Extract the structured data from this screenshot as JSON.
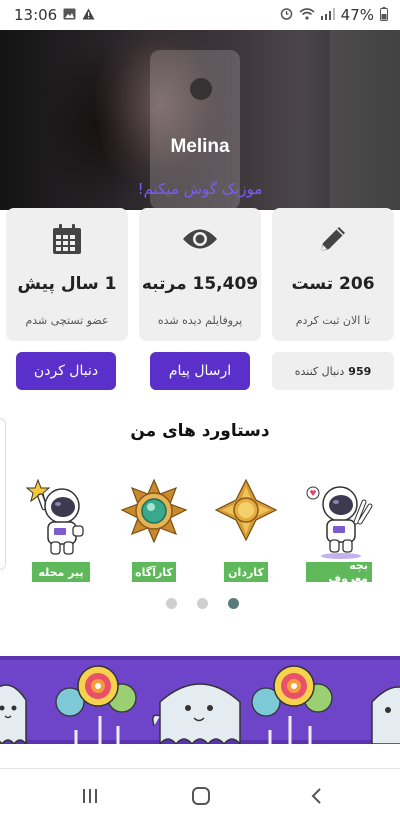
{
  "status_bar": {
    "time": "13:06",
    "battery": "47%",
    "icons": [
      "image-icon",
      "warning-icon",
      "alarm-icon",
      "wifi-icon",
      "signal-icon",
      "battery-icon"
    ]
  },
  "profile": {
    "name": "Melina",
    "bio": "موزیک گوش میکنم!"
  },
  "stats": [
    {
      "icon": "pencil-icon",
      "value": "206 تست",
      "label": "تا الان ثبت کردم"
    },
    {
      "icon": "eye-icon",
      "value": "15,409 مرتبه",
      "label": "پروفایلم دیده شده"
    },
    {
      "icon": "calendar-icon",
      "value": "1 سال پیش",
      "label": "عضو تستچی شدم"
    }
  ],
  "actions": {
    "followers_count": "959",
    "followers_label": "دنبال کننده",
    "message_button": "ارسال پیام",
    "follow_button": "دنبال کردن"
  },
  "achievements": {
    "title": "دستاورد های من",
    "badges": [
      {
        "label": "بچه معروف",
        "icon": "astronaut-peace-icon"
      },
      {
        "label": "کاردان",
        "icon": "gold-medal-icon"
      },
      {
        "label": "کارآگاه",
        "icon": "emerald-medal-icon"
      },
      {
        "label": "پیر محله",
        "icon": "astronaut-star-icon"
      }
    ],
    "pages": 3,
    "active_page": 3
  },
  "colors": {
    "accent": "#5b2fc9",
    "bio": "#7b5cf5",
    "badge_green": "#5fb85a",
    "banner": "#6e45c9"
  },
  "nav": [
    "recent-apps-icon",
    "home-icon",
    "back-icon"
  ]
}
